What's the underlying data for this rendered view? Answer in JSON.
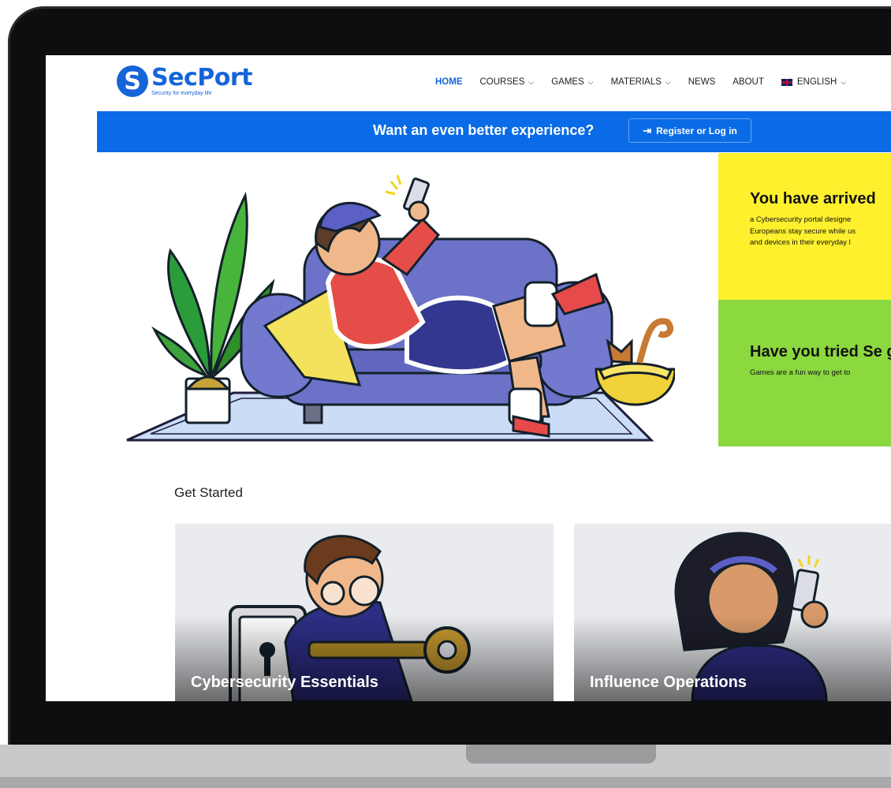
{
  "brand": {
    "name": "SecPort",
    "tagline": "Security for everyday life",
    "color": "#1565d8"
  },
  "nav": {
    "items": [
      {
        "label": "HOME",
        "active": true,
        "dropdown": false
      },
      {
        "label": "COURSES",
        "dropdown": true
      },
      {
        "label": "GAMES",
        "dropdown": true
      },
      {
        "label": "MATERIALS",
        "dropdown": true
      },
      {
        "label": "NEWS",
        "dropdown": false
      },
      {
        "label": "ABOUT",
        "dropdown": false
      }
    ],
    "language": "ENGLISH",
    "chevron": "⌄"
  },
  "banner": {
    "text": "Want an even better experience?",
    "button_label": "Register or Log in",
    "color": "#0a6be6"
  },
  "hero": {
    "tiles": [
      {
        "title": "You have arrived",
        "desc": "a Cybersecurity portal designe\nEuropeans stay secure while us\nand devices in their everyday l",
        "color": "#fff02e"
      },
      {
        "title": "Have you tried Se games?",
        "desc": "Games are a fun way to get to",
        "color": "#8bd83f"
      }
    ]
  },
  "get_started": {
    "title": "Get Started",
    "cards": [
      {
        "label": "Cybersecurity Essentials"
      },
      {
        "label": "Influence Operations"
      }
    ]
  },
  "icons": {
    "logo": "shield-s-icon",
    "login": "login-arrow-icon",
    "flag": "uk-flag-icon"
  }
}
